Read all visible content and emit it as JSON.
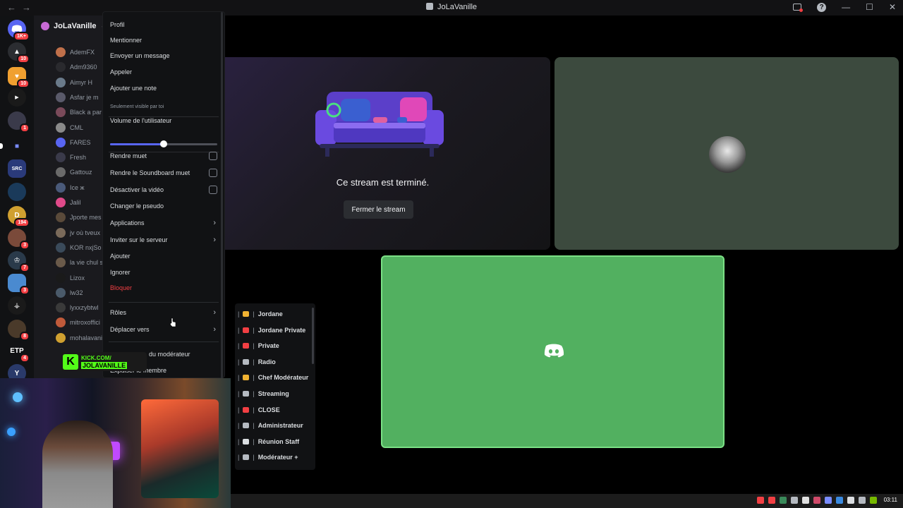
{
  "window": {
    "title": "JoLaVanille",
    "nav_back": "←",
    "nav_forward": "→",
    "help_label": "?",
    "minimize": "—",
    "maximize": "☐",
    "close": "✕"
  },
  "server": {
    "name": "JoLaVanille",
    "chevron": "⌄"
  },
  "rail": {
    "badges": [
      "1K+",
      "10",
      "10",
      "1",
      "194",
      "3",
      "7",
      "3",
      "8",
      "4"
    ],
    "etp_label": "ETP"
  },
  "members": [
    "AdemFX",
    "Adm9360",
    "Aimyr H",
    "Asfar je m",
    "Black a par",
    "CML",
    "FARES",
    "Fresh",
    "Gattouz",
    "Ice ж",
    "Jalil",
    "Jporte mes",
    "jv où tveux",
    "KOR nxjSo",
    "la vie chul s",
    "Lizox",
    "lw32",
    "lyxxzybtwl",
    "mitroxoffici",
    "mohalavani"
  ],
  "context_menu": {
    "profile": "Profil",
    "mention": "Mentionner",
    "send_message": "Envoyer un message",
    "call": "Appeler",
    "add_note": "Ajouter une note",
    "add_note_sub": "Seulement visible par toi",
    "user_volume": "Volume de l'utilisateur",
    "volume_fraction": 0.5,
    "mute": "Rendre muet",
    "soundboard_mute": "Rendre le Soundboard muet",
    "disable_video": "Désactiver la vidéo",
    "change_nickname": "Changer le pseudo",
    "apps": "Applications",
    "invite_server": "Inviter sur le serveur",
    "add": "Ajouter",
    "ignore": "Ignorer",
    "block": "Bloquer",
    "roles": "Rôles",
    "move_to": "Déplacer vers",
    "mod_view": "du modérateur",
    "kick_member": "Expulser le membre"
  },
  "roles_menu": [
    {
      "label": "Jordane",
      "color": "#f0b232"
    },
    {
      "label": "Jordane Private",
      "color": "#f23f43"
    },
    {
      "label": "Private",
      "color": "#f23f43"
    },
    {
      "label": "Radio",
      "color": "#b5bac1"
    },
    {
      "label": "Chef Modérateur",
      "color": "#f0b232"
    },
    {
      "label": "Streaming",
      "color": "#b5bac1"
    },
    {
      "label": "CLOSE",
      "color": "#f23f43"
    },
    {
      "label": "Administrateur",
      "color": "#b5bac1"
    },
    {
      "label": "Réunion Staff",
      "color": "#dbdee1"
    },
    {
      "label": "Modérateur +",
      "color": "#b5bac1"
    }
  ],
  "stage": {
    "ended_text": "Ce stream est terminé.",
    "close_stream": "Fermer le stream"
  },
  "kick": {
    "logo": "K",
    "line1": "KICK.COM/",
    "line2": "JOLAVANILLE"
  },
  "taskbar": {
    "clock": "03:11"
  }
}
